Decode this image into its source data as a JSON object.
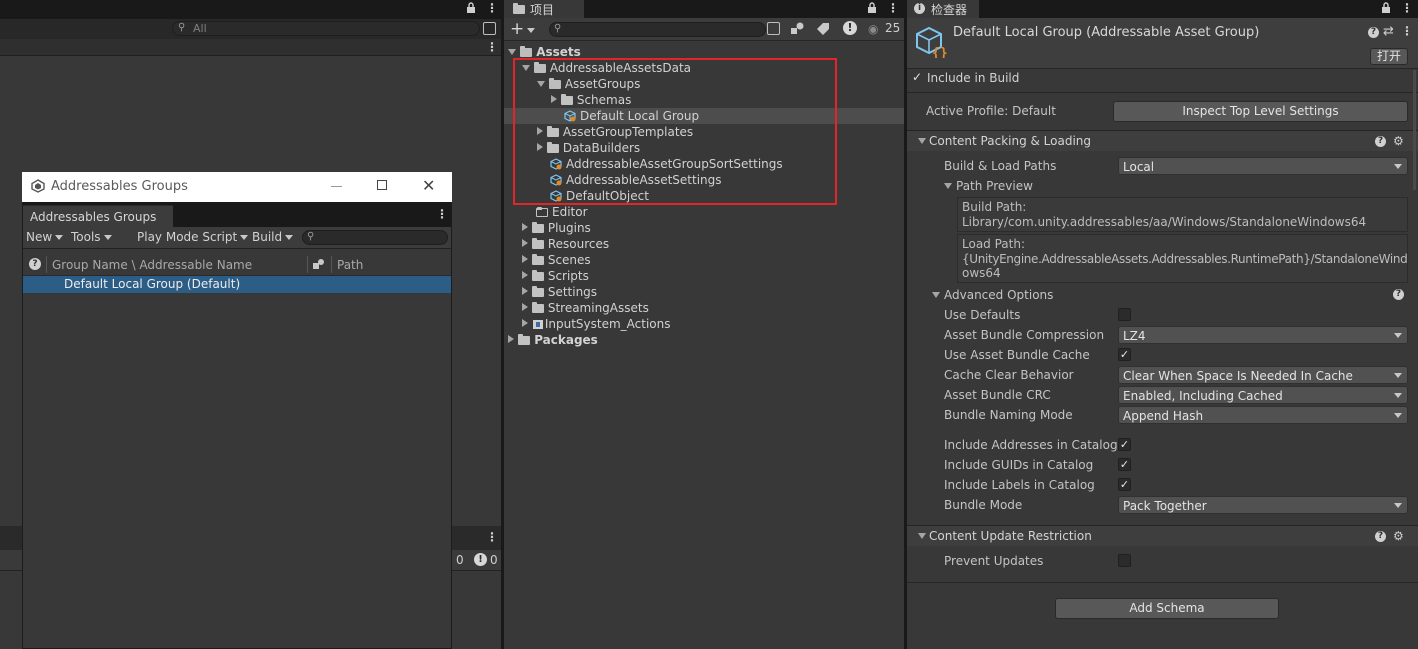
{
  "left_panel": {
    "search_placeholder": "All"
  },
  "addr_window": {
    "title": "Addressables Groups",
    "tab": "Addressables Groups",
    "toolbar": {
      "new": "New",
      "tools": "Tools",
      "play_mode": "Play Mode Script",
      "build": "Build"
    },
    "columns": {
      "group_name": "Group Name \\ Addressable Name",
      "path": "Path"
    },
    "rows": [
      "Default Local Group (Default)"
    ]
  },
  "console_counts": {
    "warnings": "0",
    "errors": "0"
  },
  "project": {
    "tab": "项目",
    "hidden_count": "25",
    "tree": {
      "assets": "Assets",
      "addressable_data": "AddressableAssetsData",
      "asset_groups": "AssetGroups",
      "schemas": "Schemas",
      "default_local_group": "Default Local Group",
      "group_templates": "AssetGroupTemplates",
      "data_builders": "DataBuilders",
      "sort_settings": "AddressableAssetGroupSortSettings",
      "asset_settings": "AddressableAssetSettings",
      "default_object": "DefaultObject",
      "editor": "Editor",
      "plugins": "Plugins",
      "resources": "Resources",
      "scenes": "Scenes",
      "scripts": "Scripts",
      "settings": "Settings",
      "streaming": "StreamingAssets",
      "input_actions": "InputSystem_Actions",
      "packages": "Packages"
    },
    "highlight_color": "#e0252b"
  },
  "inspector": {
    "tab": "检查器",
    "title": "Default Local Group (Addressable Asset Group)",
    "open_button": "打开",
    "include_in_build": "Include in Build",
    "active_profile": "Active Profile: Default",
    "inspect_top_button": "Inspect Top Level Settings",
    "content_packing": {
      "header": "Content Packing & Loading",
      "build_load_paths_label": "Build & Load Paths",
      "build_load_paths_value": "Local",
      "path_preview": "Path Preview",
      "build_path_label": "Build Path:",
      "build_path_value": "Library/com.unity.addressables/aa/Windows/StandaloneWindows64",
      "load_path_label": "Load Path:",
      "load_path_value_1": "{UnityEngine.AddressableAssets.Addressables.RuntimePath}/StandaloneWind",
      "load_path_value_2": "ows64",
      "advanced_options": "Advanced Options",
      "use_defaults": "Use Defaults",
      "compression_label": "Asset Bundle Compression",
      "compression_value": "LZ4",
      "use_cache": "Use Asset Bundle Cache",
      "cache_clear_label": "Cache Clear Behavior",
      "cache_clear_value": "Clear When Space Is Needed In Cache",
      "crc_label": "Asset Bundle CRC",
      "crc_value": "Enabled, Including Cached",
      "naming_label": "Bundle Naming Mode",
      "naming_value": "Append Hash",
      "include_addresses": "Include Addresses in Catalog",
      "include_guids": "Include GUIDs in Catalog",
      "include_labels": "Include Labels in Catalog",
      "bundle_mode_label": "Bundle Mode",
      "bundle_mode_value": "Pack Together"
    },
    "content_update": {
      "header": "Content Update Restriction",
      "prevent_updates": "Prevent Updates"
    },
    "add_schema_button": "Add Schema"
  }
}
